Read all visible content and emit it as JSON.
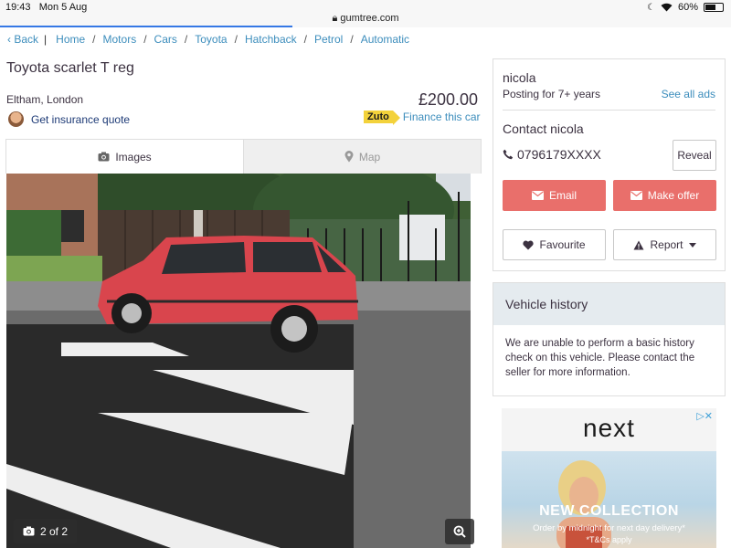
{
  "statusbar": {
    "time": "19:43",
    "date": "Mon 5 Aug",
    "url": "gumtree.com",
    "battery": "60%",
    "battery_level": 0.6
  },
  "breadcrumb": {
    "back": "Back",
    "items": [
      "Home",
      "Motors",
      "Cars",
      "Toyota",
      "Hatchback",
      "Petrol",
      "Automatic"
    ],
    "separator": "/"
  },
  "listing": {
    "title": "Toyota scarlet T reg",
    "location": "Eltham, London",
    "price": "£200.00",
    "insurance_link": "Get insurance quote",
    "finance_brand": "Zuto",
    "finance_link": "Finance this car"
  },
  "tabs": {
    "images": "Images",
    "map": "Map"
  },
  "photo": {
    "counter": "2 of 2"
  },
  "seller": {
    "name": "nicola",
    "posting": "Posting for 7+ years",
    "see_all": "See all ads",
    "contact_title": "Contact nicola",
    "phone": "0796179XXXX",
    "reveal": "Reveal",
    "email": "Email",
    "make_offer": "Make offer",
    "favourite": "Favourite",
    "report": "Report"
  },
  "vehicle_history": {
    "title": "Vehicle history",
    "body": "We are unable to perform a basic history check on this vehicle. Please contact the seller for more information."
  },
  "ad": {
    "brand": "next",
    "headline": "NEW COLLECTION",
    "subline": "Order by midnight for next day delivery*",
    "terms": "*T&Cs apply"
  },
  "colors": {
    "link": "#3c8dbc",
    "accent_red": "#e96f6b",
    "history_header": "#e5ebef",
    "zuto_yellow": "#f3d23b"
  }
}
